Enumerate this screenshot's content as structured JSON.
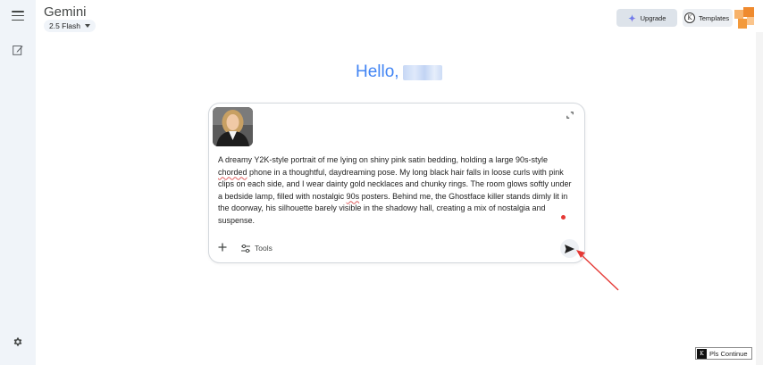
{
  "app": {
    "title": "Gemini",
    "model_label": "2.5 Flash"
  },
  "header": {
    "upgrade_label": "Upgrade",
    "templates_label": "Templates",
    "templates_icon_letter": "K"
  },
  "greeting": {
    "text": "Hello,"
  },
  "prompt": {
    "segments": [
      {
        "text": "A dreamy Y2K-style portrait of me lying on shiny pink satin bedding, holding a large 90s-style ",
        "flag": false
      },
      {
        "text": "chorded",
        "flag": true
      },
      {
        "text": " phone in a thoughtful, daydreaming pose. My long black hair falls in loose curls with pink clips on each side, and I wear dainty gold necklaces and chunky rings. The room glows softly under a bedside lamp, filled with nostalgic ",
        "flag": false
      },
      {
        "text": "90s",
        "flag": true
      },
      {
        "text": " posters. Behind me, the Ghostface killer stands dimly lit in the doorway, his silhouette barely visible in the shadowy hall, creating a mix of nostalgia and suspense.",
        "flag": false
      }
    ]
  },
  "toolbar": {
    "tools_label": "Tools"
  },
  "overlay": {
    "continue_label": "Pls Continue",
    "continue_icon_letter": "K"
  },
  "icons": {
    "menu": "menu-icon",
    "edit": "edit-icon",
    "settings": "gear-icon",
    "sparkle": "sparkle-icon",
    "expand": "expand-icon",
    "add": "plus-icon",
    "tools": "sliders-icon",
    "send": "send-icon"
  },
  "colors": {
    "greeting": "#4285f4",
    "annotation_arrow": "#e53935",
    "rail": "#f0f4f9"
  }
}
